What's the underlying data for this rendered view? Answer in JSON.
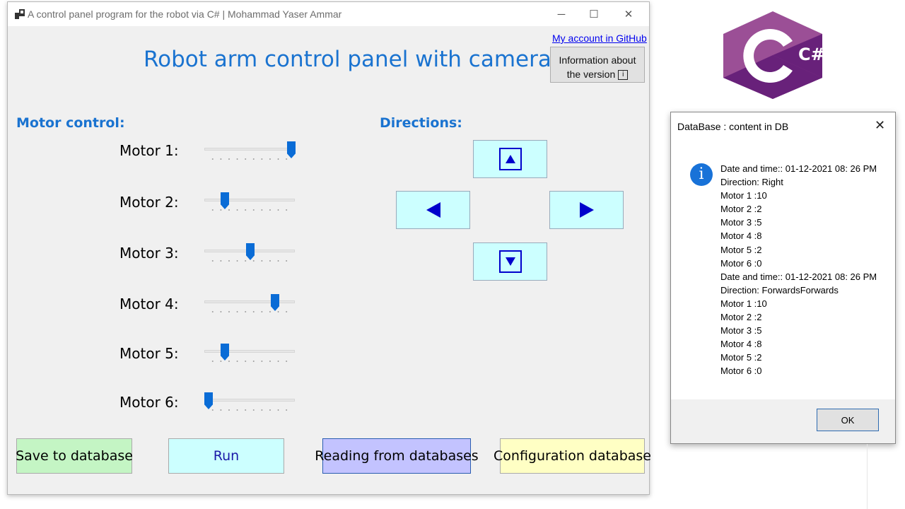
{
  "window": {
    "title": "A control panel program for the robot via C# | Mohammad Yaser Ammar",
    "controls": {
      "minimize": "─",
      "maximize": "☐",
      "close": "✕"
    }
  },
  "header": {
    "github_link": "My account in GitHub",
    "version_button": "Information about the version",
    "version_icon": "i",
    "app_title": "Robot arm control panel with camera"
  },
  "motor_control": {
    "heading": "Motor control:",
    "motors": [
      {
        "label": "Motor 1:",
        "value": 10
      },
      {
        "label": "Motor 2:",
        "value": 2
      },
      {
        "label": "Motor 3:",
        "value": 5
      },
      {
        "label": "Motor 4:",
        "value": 8
      },
      {
        "label": "Motor 5:",
        "value": 2
      },
      {
        "label": "Motor 6:",
        "value": 0
      }
    ],
    "slider_min": 0,
    "slider_max": 10
  },
  "directions": {
    "heading": "Directions:",
    "buttons": [
      "up",
      "left",
      "right",
      "down"
    ]
  },
  "actions": {
    "save": "Save to database",
    "run": "Run",
    "read": "Reading from databases",
    "config": "Configuration database"
  },
  "logo": {
    "text": "C#",
    "colors": {
      "dark": "#68217a",
      "mid": "#9b4f96",
      "light": "#b06fc0"
    }
  },
  "dialog": {
    "title": "DataBase : content in DB",
    "close": "✕",
    "icon": "i",
    "lines": [
      "Date and time::  01-12-2021 08: 26 PM",
      "Direction: Right",
      "Motor 1 :10",
      "Motor 2 :2",
      "Motor 3 :5",
      "Motor 4 :8",
      "Motor 5 :2",
      "Motor 6 :0",
      "Date and time::  01-12-2021 08: 26 PM",
      "Direction: ForwardsForwards",
      "Motor 1 :10",
      "Motor 2 :2",
      "Motor 3 :5",
      "Motor 4 :8",
      "Motor 5 :2",
      "Motor 6 :0"
    ],
    "ok_button": "OK"
  },
  "colors": {
    "accent_blue": "#1a73d0",
    "slider_thumb": "#0a6cd6",
    "direction_bg": "#ccffff",
    "save_bg": "#c4f5c4",
    "read_bg": "#c3c3ff",
    "config_bg": "#ffffc4"
  }
}
